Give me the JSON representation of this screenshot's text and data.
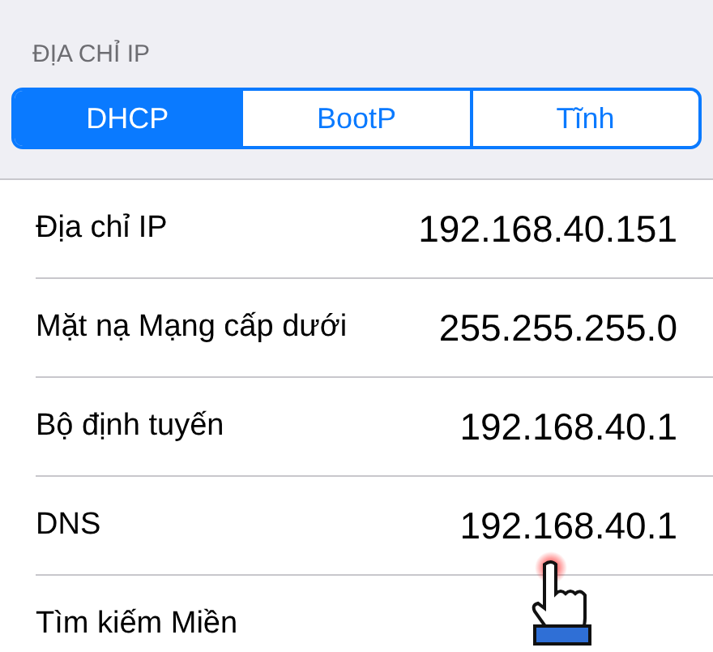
{
  "section_header": "ĐỊA CHỈ IP",
  "segments": [
    {
      "label": "DHCP",
      "selected": true
    },
    {
      "label": "BootP",
      "selected": false
    },
    {
      "label": "Tĩnh",
      "selected": false
    }
  ],
  "rows": [
    {
      "label": "Địa chỉ IP",
      "value": "192.168.40.151"
    },
    {
      "label": "Mặt nạ Mạng cấp dưới",
      "value": "255.255.255.0"
    },
    {
      "label": "Bộ định tuyến",
      "value": "192.168.40.1"
    },
    {
      "label": "DNS",
      "value": "192.168.40.1"
    },
    {
      "label": "Tìm kiếm Miền"
    }
  ]
}
